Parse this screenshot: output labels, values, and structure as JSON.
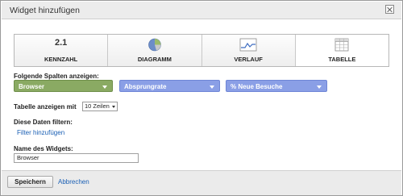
{
  "dialog": {
    "title": "Widget hinzufügen"
  },
  "tabs": [
    {
      "label": "KENNZAHL",
      "icon": "number-icon",
      "icon_text": "2.1"
    },
    {
      "label": "DIAGRAMM",
      "icon": "pie-chart-icon"
    },
    {
      "label": "VERLAUF",
      "icon": "line-chart-icon"
    },
    {
      "label": "TABELLE",
      "icon": "table-icon",
      "selected": true
    }
  ],
  "columns": {
    "heading": "Folgende Spalten anzeigen:",
    "dropdowns": [
      {
        "value": "Browser",
        "color": "#8aaa63"
      },
      {
        "value": "Absprungrate",
        "color": "#8a9fe6"
      },
      {
        "value": "% Neue Besuche",
        "color": "#8a9fe6"
      }
    ]
  },
  "table_rows": {
    "label": "Tabelle anzeigen mit",
    "value": "10 Zeilen"
  },
  "filter": {
    "heading": "Diese Daten filtern:",
    "link": "Filter hinzufügen"
  },
  "widget_name": {
    "heading": "Name des Widgets:",
    "value": "Browser"
  },
  "footer": {
    "save": "Speichern",
    "cancel": "Abbrechen"
  }
}
